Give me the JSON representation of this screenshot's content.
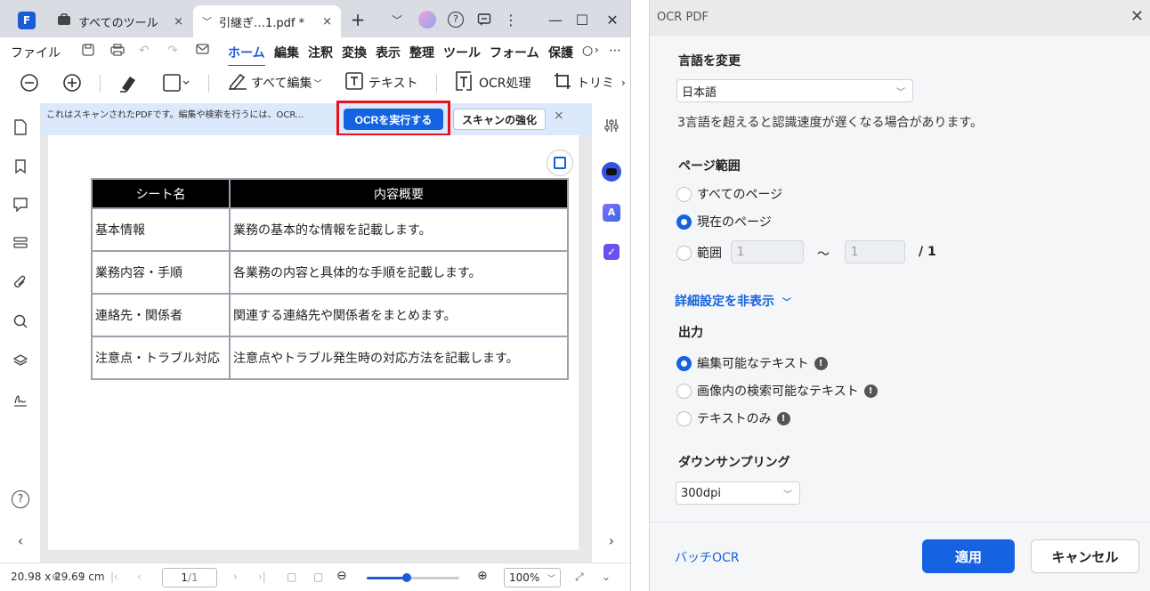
{
  "window": {
    "tabs": [
      {
        "label": "すべてのツール",
        "close": "×"
      },
      {
        "label": "引継ぎ…1.pdf *",
        "close": "×"
      }
    ],
    "new_tab": "+",
    "controls": {
      "dropdown": "﹀",
      "help": "?",
      "minimize": "—",
      "maximize": "☐",
      "close": "✕"
    }
  },
  "menu": {
    "file": "ファイル",
    "items": [
      "ホーム",
      "編集",
      "注釈",
      "変換",
      "表示",
      "整理",
      "ツール",
      "フォーム",
      "保護"
    ],
    "active": "ホーム",
    "more": "⋯"
  },
  "toolbar": {
    "edit_all": "すべて編集",
    "text": "テキスト",
    "ocr": "OCR処理",
    "trim": "トリミ"
  },
  "notice": {
    "text": "これはスキャンされたPDFです。編集や検索を行うには、OCR...",
    "ocr_button": "OCRを実行する",
    "enhance_button": "スキャンの強化",
    "close": "×"
  },
  "document": {
    "headers": [
      "シート名",
      "内容概要"
    ],
    "rows": [
      [
        "基本情報",
        "業務の基本的な情報を記載します。"
      ],
      [
        "業務内容・手順",
        "各業務の内容と具体的な手順を記載します。"
      ],
      [
        "連絡先・関係者",
        "関連する連絡先や関係者をまとめます。"
      ],
      [
        "注意点・トラブル対応",
        "注意点やトラブル発生時の対応方法を記載します。"
      ]
    ]
  },
  "status": {
    "dimensions": "20.98 x 29.69 cm",
    "page": "1",
    "page_total": "/1",
    "zoom": "100%",
    "zoom_level": 0.43
  },
  "dialog": {
    "title": "OCR PDF",
    "close": "✕",
    "language_heading": "言語を変更",
    "language_value": "日本語",
    "language_note": "3言語を超えると認識速度が遅くなる場合があります。",
    "page_range_heading": "ページ範囲",
    "page_options": [
      "すべてのページ",
      "現在のページ",
      "範囲"
    ],
    "page_selected": 1,
    "range_from": "1",
    "range_sep": "～",
    "range_to": "1",
    "range_total": "/ 1",
    "advanced_toggle": "詳細設定を非表示",
    "output_heading": "出力",
    "output_options": [
      "編集可能なテキスト",
      "画像内の検索可能なテキスト",
      "テキストのみ"
    ],
    "output_selected": 0,
    "downsampling_heading": "ダウンサンプリング",
    "downsampling_value": "300dpi",
    "batch_link": "バッチOCR",
    "apply": "適用",
    "cancel": "キャンセル"
  },
  "colors": {
    "accent": "#1563e0",
    "highlight": "#e8101c",
    "notice_bg": "#dce8fb"
  }
}
